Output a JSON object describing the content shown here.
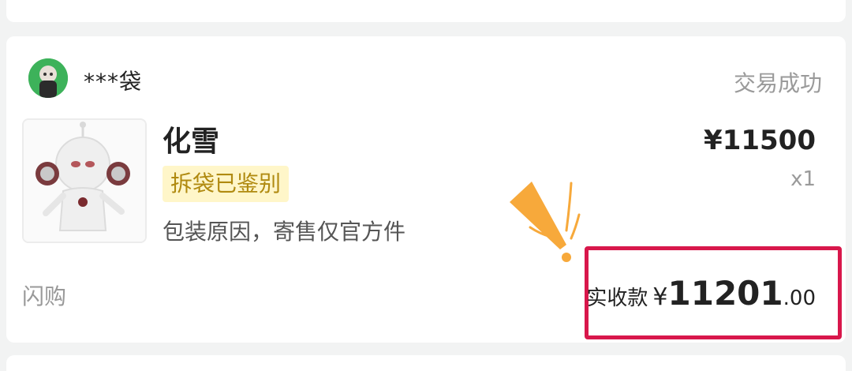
{
  "order": {
    "seller_name": "***袋",
    "status": "交易成功",
    "product": {
      "name": "化雪",
      "tag": "拆袋已鉴别",
      "note": "包装原因，寄售仅官方件",
      "price": "¥11500",
      "quantity": "x1"
    },
    "source": "闪购",
    "received": {
      "label": "实收款",
      "currency": "¥",
      "integer": "11201",
      "decimal": ".00"
    }
  },
  "colors": {
    "highlight_border": "#d8174b",
    "tag_bg": "#fff6c9",
    "tag_text": "#b08a10",
    "exclaim": "#f7a93b"
  }
}
